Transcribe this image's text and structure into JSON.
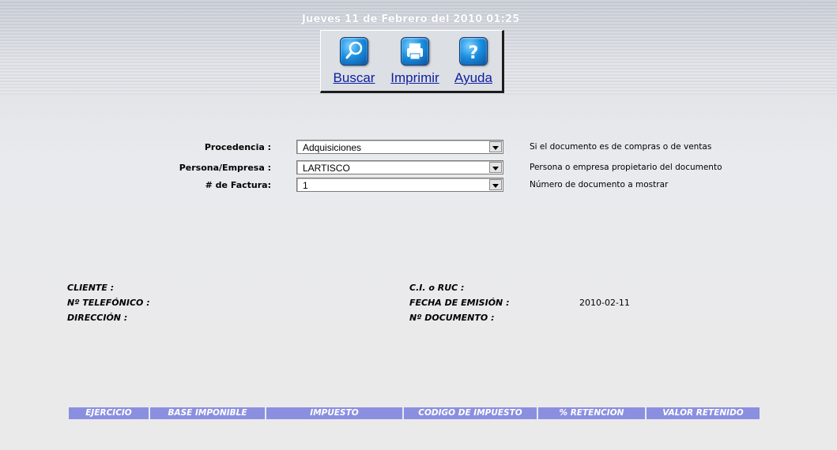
{
  "header": {
    "date_time": "Jueves 11 de Febrero del 2010 01:25"
  },
  "toolbar": {
    "buttons": [
      {
        "label": "Buscar",
        "icon": "magnifier-icon"
      },
      {
        "label": "Imprimir",
        "icon": "printer-icon"
      },
      {
        "label": "Ayuda",
        "icon": "help-icon"
      }
    ]
  },
  "form": {
    "procedencia": {
      "label": "Procedencia :",
      "value": "Adquisiciones",
      "hint": "Si el documento es de compras o de ventas"
    },
    "persona": {
      "label": "Persona/Empresa :",
      "value": "LARTISCO",
      "hint": "Persona o empresa propietario del documento"
    },
    "factura": {
      "label": "# de Factura:",
      "value": "1",
      "hint": "Número de documento a mostrar"
    }
  },
  "info": {
    "cliente": "CLIENTE :",
    "telefono": "Nº TELEFÓNICO :",
    "direccion": "DIRECCIÓN :",
    "ruc": "C.I. o RUC :",
    "fecha_label": "FECHA DE EMISIÓN :",
    "fecha_value": "2010-02-11",
    "documento": "Nº DOCUMENTO :"
  },
  "table": {
    "columns": [
      "EJERCICIO",
      "BASE IMPONIBLE",
      "IMPUESTO",
      "CODIGO DE IMPUESTO",
      "% RETENCION",
      "VALOR RETENIDO"
    ]
  },
  "colors": {
    "table_header": "#8b8fe0",
    "link": "#1020a0",
    "icon_blue": "#1a8fe0"
  }
}
